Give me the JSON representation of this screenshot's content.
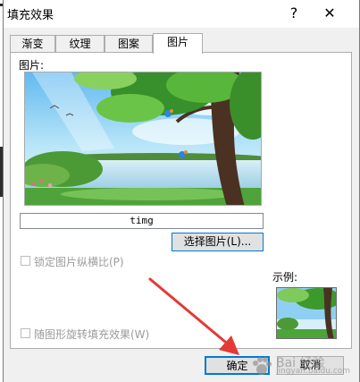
{
  "dialog": {
    "title": "填充效果",
    "help_label": "?",
    "close_label": "✕"
  },
  "tabs": [
    {
      "label": "渐变",
      "active": false
    },
    {
      "label": "纹理",
      "active": false
    },
    {
      "label": "图案",
      "active": false
    },
    {
      "label": "图片",
      "active": true
    }
  ],
  "picture_panel": {
    "picture_label": "图片:",
    "file_name": "timg",
    "select_button_label": "选择图片(L)...",
    "lock_aspect_label": "锁定图片纵横比(P)",
    "rotate_with_shape_label": "随图形旋转填充效果(W)",
    "example_label": "示例:"
  },
  "footer": {
    "ok_label": "确定",
    "cancel_label": "取消"
  },
  "watermark": {
    "text": "Bai  经验",
    "url": "jingyan.baidu.com"
  },
  "colors": {
    "accent": "#0078d7",
    "annotation_arrow": "#e53935"
  }
}
